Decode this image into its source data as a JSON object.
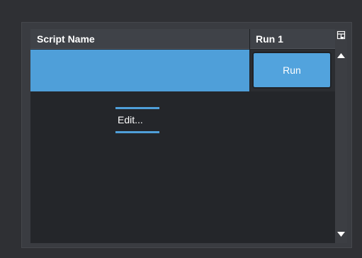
{
  "table": {
    "columns": [
      {
        "label": "Script Name"
      },
      {
        "label": "Run 1"
      }
    ],
    "rows": [
      {
        "script_name": "",
        "run_button_label": "Run"
      }
    ]
  },
  "context_menu": {
    "edit_label": "Edit..."
  },
  "icons": {
    "column_chooser": "table-columns-icon",
    "scroll_up": "triangle-up-icon",
    "scroll_down": "triangle-down-icon"
  },
  "colors": {
    "selection": "#4f9fd9",
    "run_button": "#52a3dd",
    "background": "#24262a",
    "header": "#3f4248"
  }
}
